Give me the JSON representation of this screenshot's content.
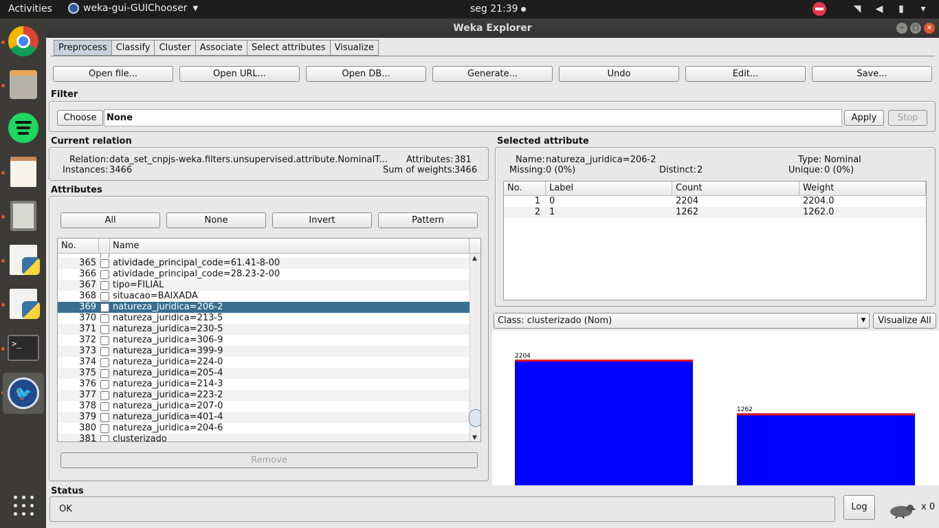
{
  "topbar": {
    "activities": "Activities",
    "app_name": "weka-gui-GUIChooser",
    "clock": "seg 21:39"
  },
  "launcher": {
    "items": [
      "chrome-icon",
      "files-icon",
      "spotify-icon",
      "text-editor-icon",
      "calculator-icon",
      "python-file-icon",
      "python-file-icon",
      "terminal-icon",
      "weka-icon",
      "show-apps-icon"
    ]
  },
  "window": {
    "title": "Weka Explorer"
  },
  "tabs": [
    "Preprocess",
    "Classify",
    "Cluster",
    "Associate",
    "Select attributes",
    "Visualize"
  ],
  "toolbar": {
    "open_file": "Open file...",
    "open_url": "Open URL...",
    "open_db": "Open DB...",
    "generate": "Generate...",
    "undo": "Undo",
    "edit": "Edit...",
    "save": "Save..."
  },
  "filter": {
    "title": "Filter",
    "choose": "Choose",
    "value": "None",
    "apply": "Apply",
    "stop": "Stop"
  },
  "current_relation": {
    "title": "Current relation",
    "relation_label": "Relation:",
    "relation": "data_set_cnpjs-weka.filters.unsupervised.attribute.NominalT...",
    "instances_label": "Instances:",
    "instances": "3466",
    "attributes_label": "Attributes:",
    "attributes": "381",
    "sum_label": "Sum of weights:",
    "sum": "3466"
  },
  "attributes": {
    "title": "Attributes",
    "btn_all": "All",
    "btn_none": "None",
    "btn_invert": "Invert",
    "btn_pattern": "Pattern",
    "col_no": "No.",
    "col_name": "Name",
    "rows": [
      {
        "no": "365",
        "name": "atividade_principal_code=61.41-8-00"
      },
      {
        "no": "366",
        "name": "atividade_principal_code=28.23-2-00"
      },
      {
        "no": "367",
        "name": "tipo=FILIAL"
      },
      {
        "no": "368",
        "name": "situacao=BAIXADA"
      },
      {
        "no": "369",
        "name": "natureza_juridica=206-2"
      },
      {
        "no": "370",
        "name": "natureza_juridica=213-5"
      },
      {
        "no": "371",
        "name": "natureza_juridica=230-5"
      },
      {
        "no": "372",
        "name": "natureza_juridica=306-9"
      },
      {
        "no": "373",
        "name": "natureza_juridica=399-9"
      },
      {
        "no": "374",
        "name": "natureza_juridica=224-0"
      },
      {
        "no": "375",
        "name": "natureza_juridica=205-4"
      },
      {
        "no": "376",
        "name": "natureza_juridica=214-3"
      },
      {
        "no": "377",
        "name": "natureza_juridica=223-2"
      },
      {
        "no": "378",
        "name": "natureza_juridica=207-0"
      },
      {
        "no": "379",
        "name": "natureza_juridica=401-4"
      },
      {
        "no": "380",
        "name": "natureza_juridica=204-6"
      },
      {
        "no": "381",
        "name": "clusterizado"
      }
    ],
    "selected_row": 4,
    "remove": "Remove"
  },
  "selected_attribute": {
    "title": "Selected attribute",
    "name_label": "Name:",
    "name": "natureza_juridica=206-2",
    "type_label": "Type:",
    "type": "Nominal",
    "missing_label": "Missing:",
    "missing": "0 (0%)",
    "distinct_label": "Distinct:",
    "distinct": "2",
    "unique_label": "Unique:",
    "unique": "0 (0%)",
    "headers": [
      "No.",
      "Label",
      "Count",
      "Weight"
    ],
    "rows": [
      {
        "no": "1",
        "label": "0",
        "count": "2204",
        "weight": "2204.0"
      },
      {
        "no": "2",
        "label": "1",
        "count": "1262",
        "weight": "1262.0"
      }
    ]
  },
  "class_select": {
    "value": "Class: clusterizado (Nom)",
    "visualize_all": "Visualize All"
  },
  "chart_data": {
    "type": "bar",
    "categories": [
      "0",
      "1"
    ],
    "values": [
      2204,
      1262
    ],
    "value_labels": [
      "2204",
      "1262"
    ],
    "bar_color": "#0000ff",
    "top_stripe_color": "#e8141e"
  },
  "status": {
    "title": "Status",
    "text": "OK",
    "log": "Log",
    "count": "x 0"
  }
}
